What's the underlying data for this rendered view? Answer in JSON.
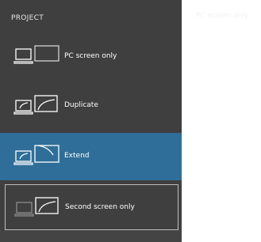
{
  "panel": {
    "title": "PROJECT",
    "options": [
      {
        "label": "PC screen only",
        "selected": false
      },
      {
        "label": "Duplicate",
        "selected": false
      },
      {
        "label": "Extend",
        "selected": true
      },
      {
        "label": "Second screen only",
        "selected": false,
        "focused": true
      }
    ]
  },
  "ghost_label": "PC screen only",
  "colors": {
    "panel_bg": "#3f3f3f",
    "selected_bg": "#2f6e98",
    "text": "#ffffff",
    "focus_border": "#bdbdbd"
  }
}
